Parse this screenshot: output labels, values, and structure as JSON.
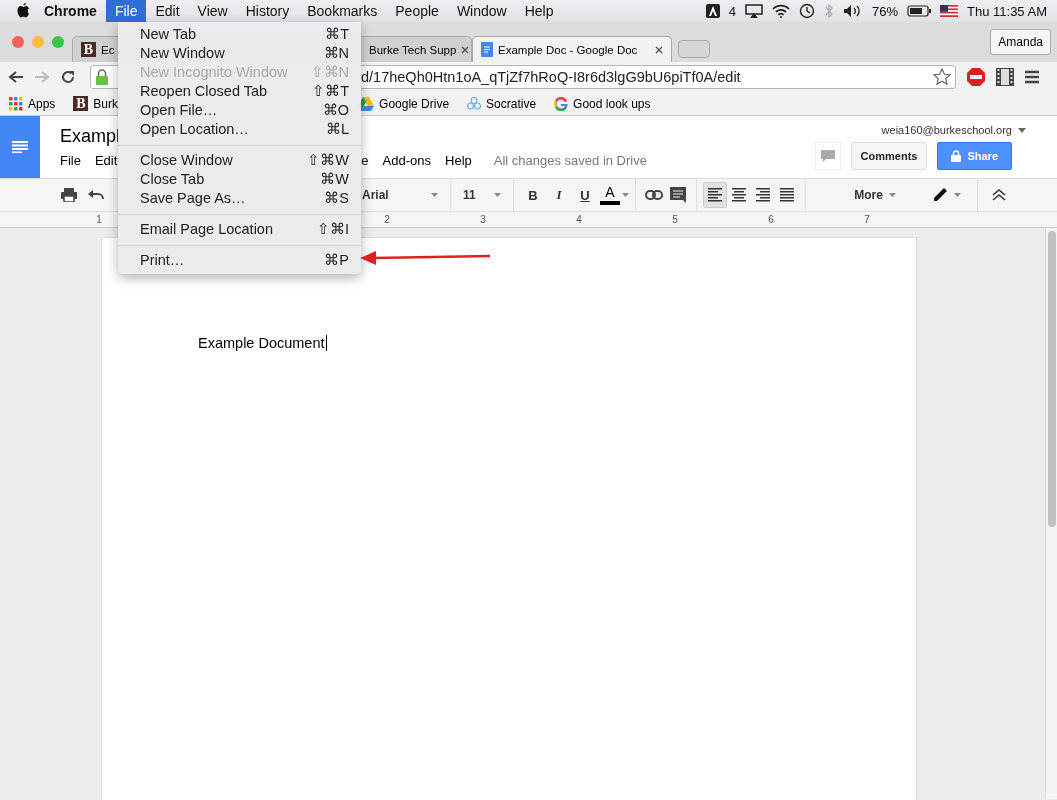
{
  "menu_bar": {
    "app": "Chrome",
    "menus": [
      {
        "label": "File",
        "selected": true
      },
      {
        "label": "Edit",
        "selected": false
      },
      {
        "label": "View",
        "selected": false
      },
      {
        "label": "History",
        "selected": false
      },
      {
        "label": "Bookmarks",
        "selected": false
      },
      {
        "label": "People",
        "selected": false
      },
      {
        "label": "Window",
        "selected": false
      },
      {
        "label": "Help",
        "selected": false
      }
    ],
    "adobe_badge": "4",
    "battery": "76%",
    "clock": "Thu 11:35 AM"
  },
  "browser": {
    "tabs": [
      {
        "title": "Ec",
        "badge": "B",
        "kind": "letter",
        "selected": false
      },
      {
        "title": "Burke Tech Supp",
        "kind": "hidden",
        "selected": false,
        "closable": true
      },
      {
        "title": "Example Doc - Google Doc",
        "kind": "docs",
        "selected": true,
        "closable": true
      }
    ],
    "profile": "Amanda",
    "url": "d/17heQh0Htn1oA_qTjZf7hRoQ-I8r6d3lgG9bU6piTf0A/edit",
    "bookmarks": [
      {
        "label": "Apps",
        "kind": "apps"
      },
      {
        "label": "Burk",
        "kind": "letter",
        "badge": "B"
      },
      {
        "label": "Google Drive",
        "kind": "drive"
      },
      {
        "label": "Socrative",
        "kind": "socrative"
      },
      {
        "label": "Good look ups",
        "kind": "google"
      }
    ]
  },
  "doc": {
    "title": "Exampl",
    "menus": [
      "File",
      "Edit",
      "e",
      "Add-ons",
      "Help"
    ],
    "save_status": "All changes saved in Drive",
    "account": "weia160@burkeschool.org",
    "comments_button": "Comments",
    "share_button": "Share",
    "toolbar": {
      "font": "Arial",
      "size": "11",
      "format_buttons": [
        {
          "label": "B",
          "kind": "bold"
        },
        {
          "label": "I",
          "kind": "italic"
        },
        {
          "label": "U",
          "kind": "underline"
        }
      ],
      "text_color": "A",
      "align_buttons": [
        {
          "kind": "left",
          "selected": true
        },
        {
          "kind": "center",
          "selected": false
        },
        {
          "kind": "right",
          "selected": false
        },
        {
          "kind": "justify",
          "selected": false
        }
      ],
      "more": "More"
    },
    "ruler": [
      "1",
      "2",
      "3",
      "4",
      "5",
      "6",
      "7"
    ],
    "body": "Example Document"
  },
  "file_menu": {
    "groups": [
      [
        {
          "label": "New Tab",
          "shortcut": "⌘T",
          "disabled": false
        },
        {
          "label": "New Window",
          "shortcut": "⌘N",
          "disabled": false
        },
        {
          "label": "New Incognito Window",
          "shortcut": "⇧⌘N",
          "disabled": true
        },
        {
          "label": "Reopen Closed Tab",
          "shortcut": "⇧⌘T",
          "disabled": false
        },
        {
          "label": "Open File…",
          "shortcut": "⌘O",
          "disabled": false
        },
        {
          "label": "Open Location…",
          "shortcut": "⌘L",
          "disabled": false
        }
      ],
      [
        {
          "label": "Close Window",
          "shortcut": "⇧⌘W",
          "disabled": false
        },
        {
          "label": "Close Tab",
          "shortcut": "⌘W",
          "disabled": false
        },
        {
          "label": "Save Page As…",
          "shortcut": "⌘S",
          "disabled": false
        }
      ],
      [
        {
          "label": "Email Page Location",
          "shortcut": "⇧⌘I",
          "disabled": false
        }
      ],
      [
        {
          "label": "Print…",
          "shortcut": "⌘P",
          "disabled": false
        }
      ]
    ]
  }
}
